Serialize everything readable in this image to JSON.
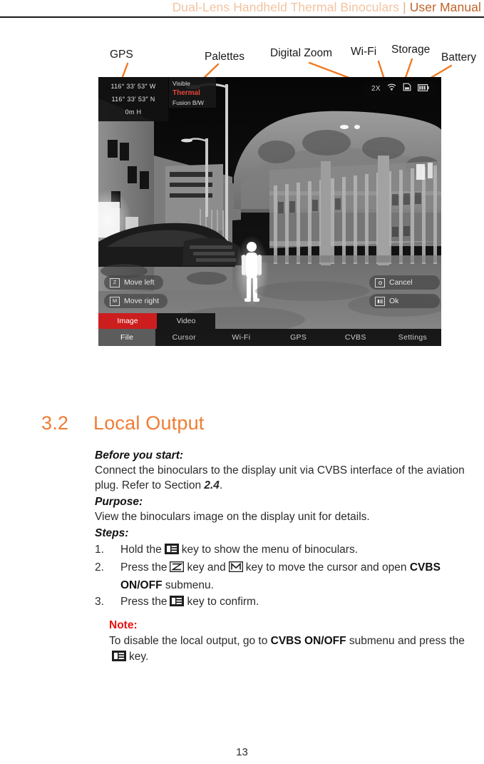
{
  "header": {
    "product": "Dual-Lens Handheld Thermal Binoculars",
    "separator": " | ",
    "manual": "User Manual"
  },
  "callouts": [
    {
      "label": "GPS",
      "name": "callout-gps"
    },
    {
      "label": "Palettes",
      "name": "callout-palettes"
    },
    {
      "label": "Digital Zoom",
      "name": "callout-digital-zoom"
    },
    {
      "label": "Wi-Fi",
      "name": "callout-wifi"
    },
    {
      "label": "Storage",
      "name": "callout-storage"
    },
    {
      "label": "Battery",
      "name": "callout-battery"
    }
  ],
  "device": {
    "gps": {
      "longitude": "116° 33′ 53″ W",
      "latitude": "116° 33′ 53″ N",
      "altitude": "0m H"
    },
    "palettes": {
      "items": [
        "Visible",
        "Thermal",
        "Fusion B/W"
      ],
      "selected": "Thermal"
    },
    "status": {
      "zoom": "2X",
      "wifi_icon": "wifi-icon",
      "storage_icon": "sd-card-icon",
      "battery_icon": "battery-icon"
    },
    "hints": {
      "move_left": {
        "key": "Z",
        "label": "Move left"
      },
      "move_right": {
        "key": "M",
        "label": "Move right"
      },
      "cancel": {
        "key": "camera-icon",
        "label": "Cancel"
      },
      "ok": {
        "key": "menu-icon",
        "label": "Ok"
      }
    },
    "tabs": [
      {
        "label": "Image",
        "active": true
      },
      {
        "label": "Video",
        "active": false
      }
    ],
    "menu": [
      {
        "label": "File",
        "active": true
      },
      {
        "label": "Cursor",
        "active": false
      },
      {
        "label": "Wi-Fi",
        "active": false
      },
      {
        "label": "GPS",
        "active": false
      },
      {
        "label": "CVBS",
        "active": false
      },
      {
        "label": "Settings",
        "active": false
      }
    ]
  },
  "section": {
    "number": "3.2",
    "title": "Local Output"
  },
  "content": {
    "before_head": "Before you start:",
    "before_text_1": "Connect the binoculars to the display unit via CVBS interface of the aviation plug. Refer to Section ",
    "before_ref": "2.4",
    "before_text_2": ".",
    "purpose_head": "Purpose:",
    "purpose_text": "View the binoculars image on the display unit for details.",
    "steps_head": "Steps:",
    "step1_num": "1.",
    "step1_a": "Hold the",
    "step1_b": "key to show the menu of binoculars.",
    "step2_num": "2.",
    "step2_a": "Press the",
    "step2_b": "key and",
    "step2_c": "key to move the cursor and open",
    "step2_bold": "CVBS ON/OFF",
    "step2_d": "submenu.",
    "step3_num": "3.",
    "step3_a": "Press the",
    "step3_b": "key to confirm.",
    "note_title": "Note:",
    "note_a": "To disable the local output, go to",
    "note_bold": "CVBS ON/OFF",
    "note_b": "submenu and press the",
    "note_c": "key."
  },
  "footer": {
    "page_number": "13"
  },
  "colors": {
    "accent_orange": "#ef7c33",
    "header_light": "#f3c3a0",
    "header_dark": "#c0632a",
    "note_red": "#e8110f",
    "tab_red": "#cc1e1e"
  }
}
